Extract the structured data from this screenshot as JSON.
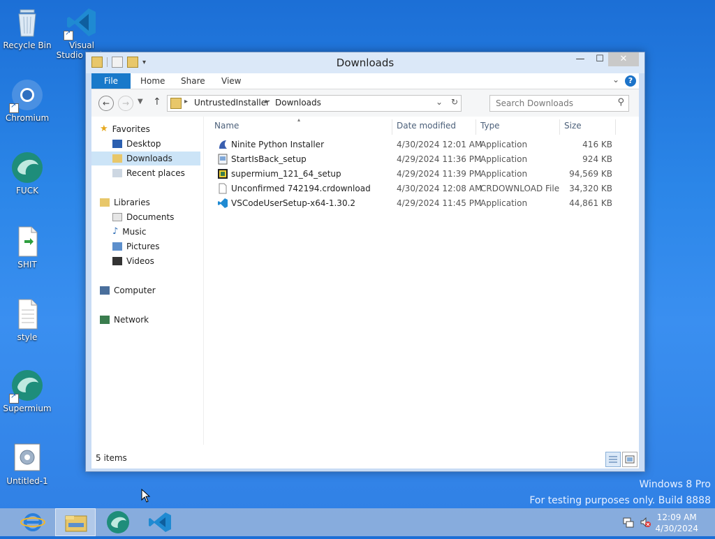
{
  "desktop": {
    "icons": [
      {
        "label": "Recycle Bin"
      },
      {
        "label": "Visual Studio Code"
      },
      {
        "label": "Chromium"
      },
      {
        "label": "FUCK"
      },
      {
        "label": "SHIT"
      },
      {
        "label": "style"
      },
      {
        "label": "Supermium"
      },
      {
        "label": "Untitled-1"
      }
    ]
  },
  "window": {
    "title": "Downloads",
    "controls": {
      "minimize": "—",
      "maximize": "☐",
      "close": "✕"
    },
    "ribbon": {
      "tabs": [
        "File",
        "Home",
        "Share",
        "View"
      ]
    },
    "address": {
      "crumbs": [
        "UntrustedInstaller",
        "Downloads"
      ]
    },
    "search": {
      "placeholder": "Search Downloads"
    },
    "nav": {
      "favorites": {
        "label": "Favorites",
        "items": [
          "Desktop",
          "Downloads",
          "Recent places"
        ]
      },
      "libraries": {
        "label": "Libraries",
        "items": [
          "Documents",
          "Music",
          "Pictures",
          "Videos"
        ]
      },
      "computer": "Computer",
      "network": "Network"
    },
    "columns": {
      "name": "Name",
      "date": "Date modified",
      "type": "Type",
      "size": "Size"
    },
    "files": [
      {
        "name": "Ninite Python Installer",
        "date": "4/30/2024 12:01 AM",
        "type": "Application",
        "size": "416 KB",
        "icon": "ninite-icon"
      },
      {
        "name": "StartIsBack_setup",
        "date": "4/29/2024 11:36 PM",
        "type": "Application",
        "size": "924 KB",
        "icon": "installer-icon"
      },
      {
        "name": "supermium_121_64_setup",
        "date": "4/29/2024 11:39 PM",
        "type": "Application",
        "size": "94,569 KB",
        "icon": "setup-icon"
      },
      {
        "name": "Unconfirmed 742194.crdownload",
        "date": "4/30/2024 12:08 AM",
        "type": "CRDOWNLOAD File",
        "size": "34,320 KB",
        "icon": "blank-file-icon"
      },
      {
        "name": "VSCodeUserSetup-x64-1.30.2",
        "date": "4/29/2024 11:45 PM",
        "type": "Application",
        "size": "44,861 KB",
        "icon": "vscode-icon"
      }
    ],
    "status": {
      "count": "5 items"
    }
  },
  "watermark": {
    "line1": "Windows 8 Pro",
    "line2": "For testing purposes only. Build 8888"
  },
  "taskbar": {
    "time": "12:09 AM",
    "date": "4/30/2024"
  }
}
